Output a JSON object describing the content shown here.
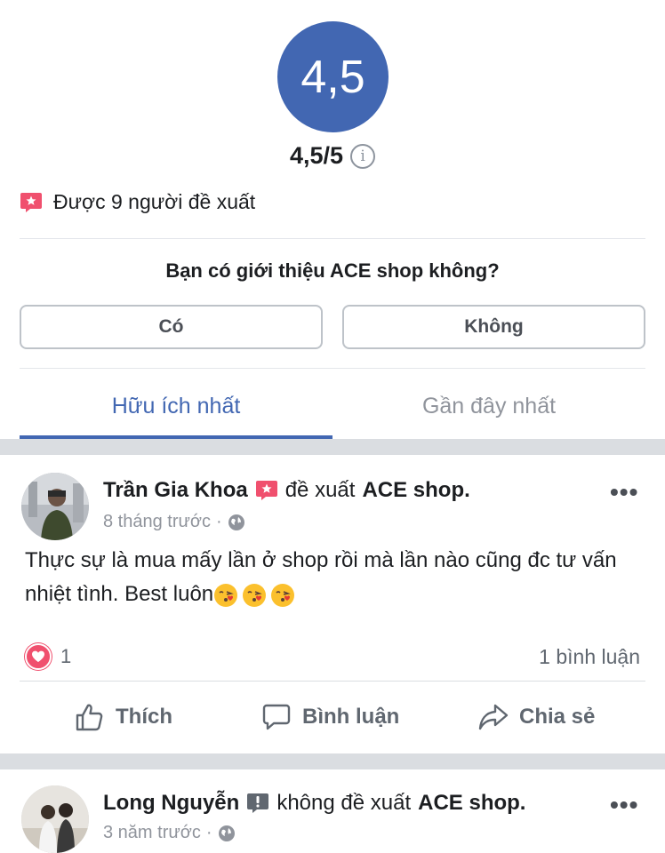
{
  "rating": {
    "score": "4,5",
    "score_full": "4,5/5",
    "info_icon": "info-icon"
  },
  "recommend": {
    "text": "Được 9 người đề xuất",
    "icon": "recommend-icon",
    "icon_color": "#f0506e"
  },
  "question": {
    "text": "Bạn có giới thiệu ACE shop không?",
    "yes_label": "Có",
    "no_label": "Không"
  },
  "tabs": [
    {
      "label": "Hữu ích nhất",
      "active": true
    },
    {
      "label": "Gần đây nhất",
      "active": false
    }
  ],
  "posts": [
    {
      "author": "Trần Gia Khoa",
      "action": "đề xuất",
      "page": "ACE shop.",
      "time": "8 tháng trước",
      "dot": "·",
      "text": "Thực sự là mua mấy lần ở shop rồi mà lần nào cũng đc tư vấn nhiệt tình. Best luôn",
      "emoji": [
        "kissing-face-emoji",
        "kissing-face-emoji",
        "kissing-face-emoji"
      ],
      "reaction_count": "1",
      "comment_count": "1 bình luận",
      "more": "•••"
    },
    {
      "author": "Long Nguyễn",
      "action": "không đề xuất",
      "page": "ACE shop.",
      "time": "3 năm trước",
      "dot": "·",
      "more": "•••"
    }
  ],
  "actions": {
    "like": "Thích",
    "comment": "Bình luận",
    "share": "Chia sẻ"
  },
  "colors": {
    "brand": "#4267b2",
    "recommend": "#f0506e",
    "not_recommend": "#606770"
  }
}
